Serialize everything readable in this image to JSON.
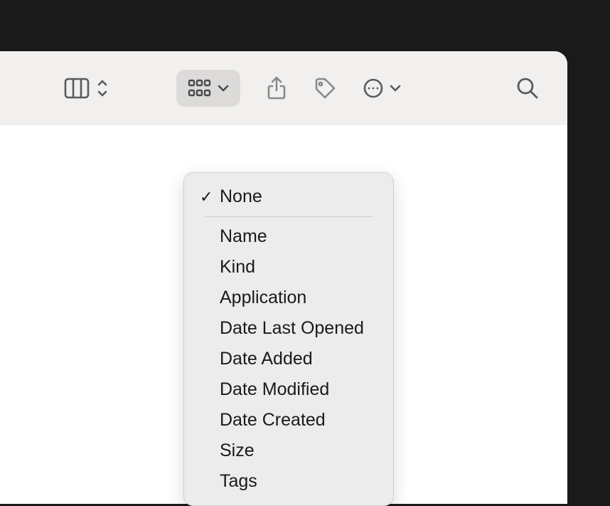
{
  "toolbar": {
    "icons": {
      "columns_view": "columns-view-icon",
      "sort_arrows": "sort-arrows-icon",
      "group": "group-icon",
      "share": "share-icon",
      "tag": "tag-icon",
      "more": "more-icon",
      "search": "search-icon"
    }
  },
  "group_menu": {
    "selected": "None",
    "items": [
      {
        "label": "None",
        "checked": true
      },
      {
        "label": "Name",
        "checked": false
      },
      {
        "label": "Kind",
        "checked": false
      },
      {
        "label": "Application",
        "checked": false
      },
      {
        "label": "Date Last Opened",
        "checked": false
      },
      {
        "label": "Date Added",
        "checked": false
      },
      {
        "label": "Date Modified",
        "checked": false
      },
      {
        "label": "Date Created",
        "checked": false
      },
      {
        "label": "Size",
        "checked": false
      },
      {
        "label": "Tags",
        "checked": false
      }
    ]
  }
}
